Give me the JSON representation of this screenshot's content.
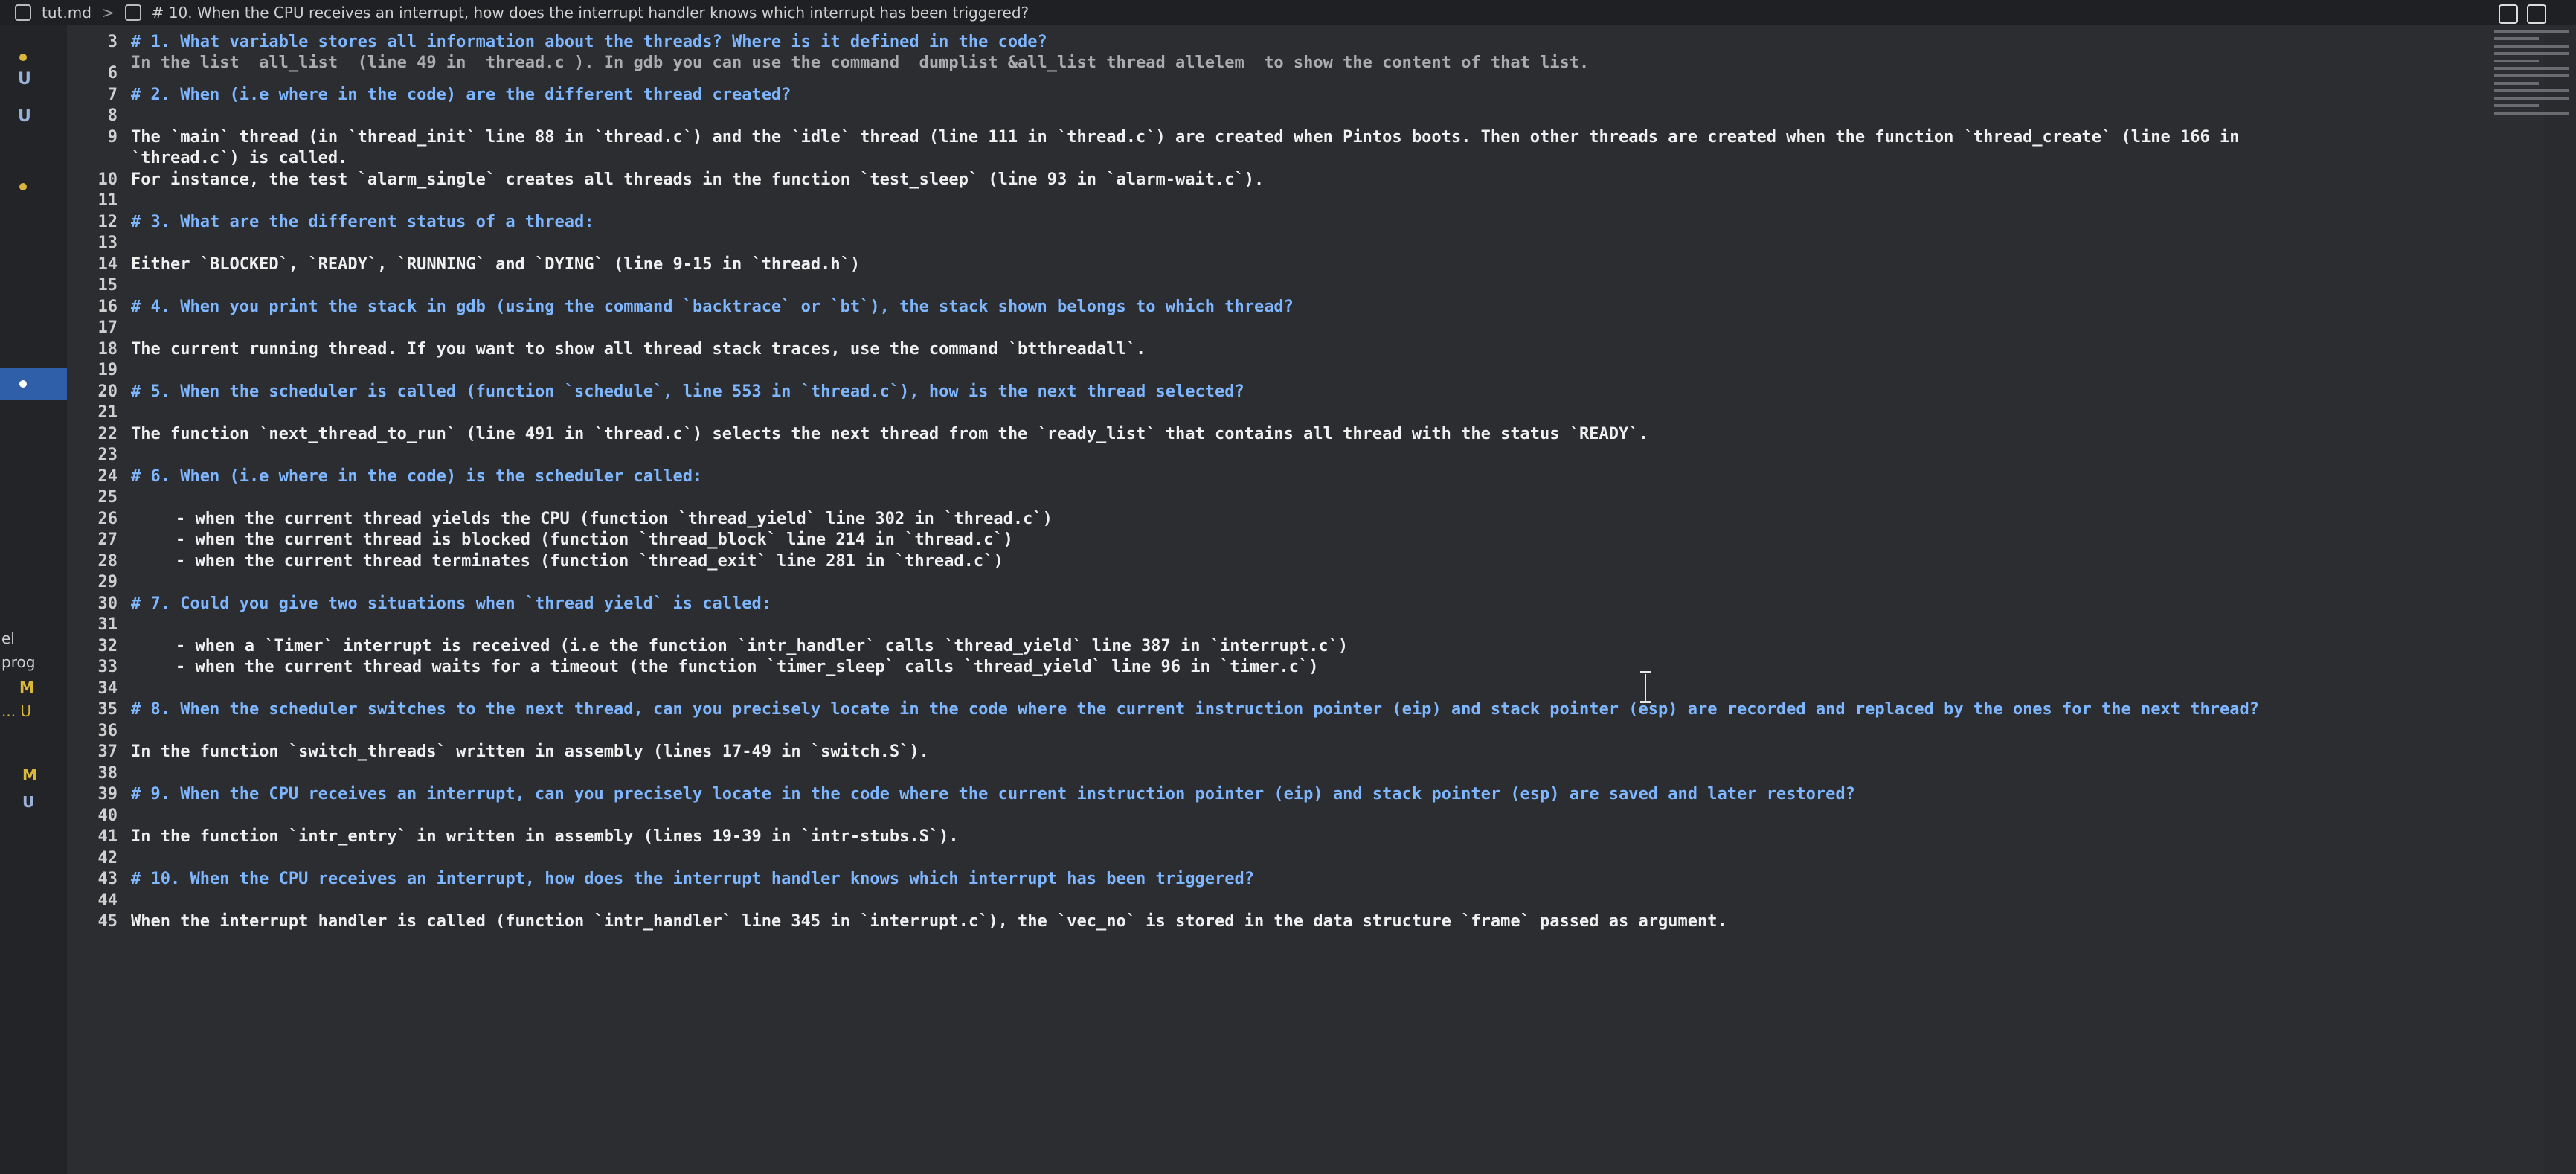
{
  "breadcrumb": {
    "file": "tut.md",
    "separator": ">",
    "section": "# 10. When the CPU receives an interrupt, how does the interrupt handler knows which interrupt has been triggered?"
  },
  "gutter": {
    "marks": [
      "U",
      "U",
      "el",
      "prog",
      "M",
      "... U",
      "M",
      "U"
    ]
  },
  "lines": [
    {
      "n": "3",
      "text": "# 1. What variable stores all information about the threads? Where is it defined in the code?",
      "kind": "heading"
    },
    {
      "n": "",
      "text": "In the list  all_list  (line 49 in  thread.c ). In gdb you can use the command  dumplist &all_list thread allelem  to show the content of that list.",
      "kind": "ans",
      "partial": true
    },
    {
      "n": "6",
      "text": "",
      "kind": "blank"
    },
    {
      "n": "7",
      "text": "# 2. When (i.e where in the code) are the different thread created?",
      "kind": "heading"
    },
    {
      "n": "8",
      "text": "",
      "kind": "blank"
    },
    {
      "n": "9",
      "text": "The `main` thread (in `thread_init` line 88 in `thread.c`) and the `idle` thread (line 111 in `thread.c`) are created when Pintos boots. Then other threads are created when the function `thread_create` (line 166 in",
      "kind": "ans"
    },
    {
      "n": "",
      "text": "`thread.c`) is called.",
      "kind": "ans"
    },
    {
      "n": "10",
      "text": "For instance, the test `alarm_single` creates all threads in the function `test_sleep` (line 93 in `alarm-wait.c`).",
      "kind": "ans"
    },
    {
      "n": "11",
      "text": "",
      "kind": "blank"
    },
    {
      "n": "12",
      "text": "# 3. What are the different status of a thread:",
      "kind": "heading"
    },
    {
      "n": "13",
      "text": "",
      "kind": "blank"
    },
    {
      "n": "14",
      "text": "Either `BLOCKED`, `READY`, `RUNNING` and `DYING` (line 9-15 in `thread.h`)",
      "kind": "ans"
    },
    {
      "n": "15",
      "text": "",
      "kind": "blank"
    },
    {
      "n": "16",
      "text": "# 4. When you print the stack in gdb (using the command `backtrace` or `bt`), the stack shown belongs to which thread?",
      "kind": "heading"
    },
    {
      "n": "17",
      "text": "",
      "kind": "blank"
    },
    {
      "n": "18",
      "text": "The current running thread. If you want to show all thread stack traces, use the command `btthreadall`.",
      "kind": "ans"
    },
    {
      "n": "19",
      "text": "",
      "kind": "blank"
    },
    {
      "n": "20",
      "text": "# 5. When the scheduler is called (function `schedule`, line 553 in `thread.c`), how is the next thread selected?",
      "kind": "heading"
    },
    {
      "n": "21",
      "text": "",
      "kind": "blank"
    },
    {
      "n": "22",
      "text": "The function `next_thread_to_run` (line 491 in `thread.c`) selects the next thread from the `ready_list` that contains all thread with the status `READY`.",
      "kind": "ans"
    },
    {
      "n": "23",
      "text": "",
      "kind": "blank"
    },
    {
      "n": "24",
      "text": "# 6. When (i.e where in the code) is the scheduler called:",
      "kind": "heading"
    },
    {
      "n": "25",
      "text": "",
      "kind": "blank"
    },
    {
      "n": "26",
      "text": "- when the current thread yields the CPU (function `thread_yield` line 302 in `thread.c`)",
      "kind": "bullet"
    },
    {
      "n": "27",
      "text": "- when the current thread is blocked (function `thread_block` line 214 in `thread.c`)",
      "kind": "bullet"
    },
    {
      "n": "28",
      "text": "- when the current thread terminates (function `thread_exit` line 281 in `thread.c`)",
      "kind": "bullet"
    },
    {
      "n": "29",
      "text": "",
      "kind": "blank"
    },
    {
      "n": "30",
      "text": "# 7. Could you give two situations when `thread yield` is called:",
      "kind": "heading"
    },
    {
      "n": "31",
      "text": "",
      "kind": "blank"
    },
    {
      "n": "32",
      "text": "- when a `Timer` interrupt is received (i.e the function `intr_handler` calls `thread_yield` line 387 in `interrupt.c`)",
      "kind": "bullet"
    },
    {
      "n": "33",
      "text": "- when the current thread waits for a timeout (the function `timer_sleep` calls `thread_yield` line 96 in `timer.c`)",
      "kind": "bullet"
    },
    {
      "n": "34",
      "text": "",
      "kind": "blank"
    },
    {
      "n": "35",
      "text": "# 8. When the scheduler switches to the next thread, can you precisely locate in the code where the current instruction pointer (eip) and stack pointer (esp) are recorded and replaced by the ones for the next thread?",
      "kind": "heading"
    },
    {
      "n": "36",
      "text": "",
      "kind": "blank"
    },
    {
      "n": "37",
      "text": "In the function `switch_threads` written in assembly (lines 17-49 in `switch.S`).",
      "kind": "ans"
    },
    {
      "n": "38",
      "text": "",
      "kind": "blank"
    },
    {
      "n": "39",
      "text": "# 9. When the CPU receives an interrupt, can you precisely locate in the code where the current instruction pointer (eip) and stack pointer (esp) are saved and later restored?",
      "kind": "heading"
    },
    {
      "n": "40",
      "text": "",
      "kind": "blank"
    },
    {
      "n": "41",
      "text": "In the function `intr_entry` in written in assembly (lines 19-39 in `intr-stubs.S`).",
      "kind": "ans"
    },
    {
      "n": "42",
      "text": "",
      "kind": "blank"
    },
    {
      "n": "43",
      "text": "# 10. When the CPU receives an interrupt, how does the interrupt handler knows which interrupt has been triggered?",
      "kind": "heading"
    },
    {
      "n": "44",
      "text": "",
      "kind": "blank"
    },
    {
      "n": "45",
      "text": "When the interrupt handler is called (function `intr_handler` line 345 in `interrupt.c`), the `vec_no` is stored in the data structure `frame` passed as argument.",
      "kind": "ans"
    }
  ],
  "colors": {
    "heading": "#7eb6ff",
    "text": "#f0f0f0",
    "line_number": "#cfcfcf",
    "background": "#2b2d31",
    "active_gutter": "#2f5fa8"
  }
}
